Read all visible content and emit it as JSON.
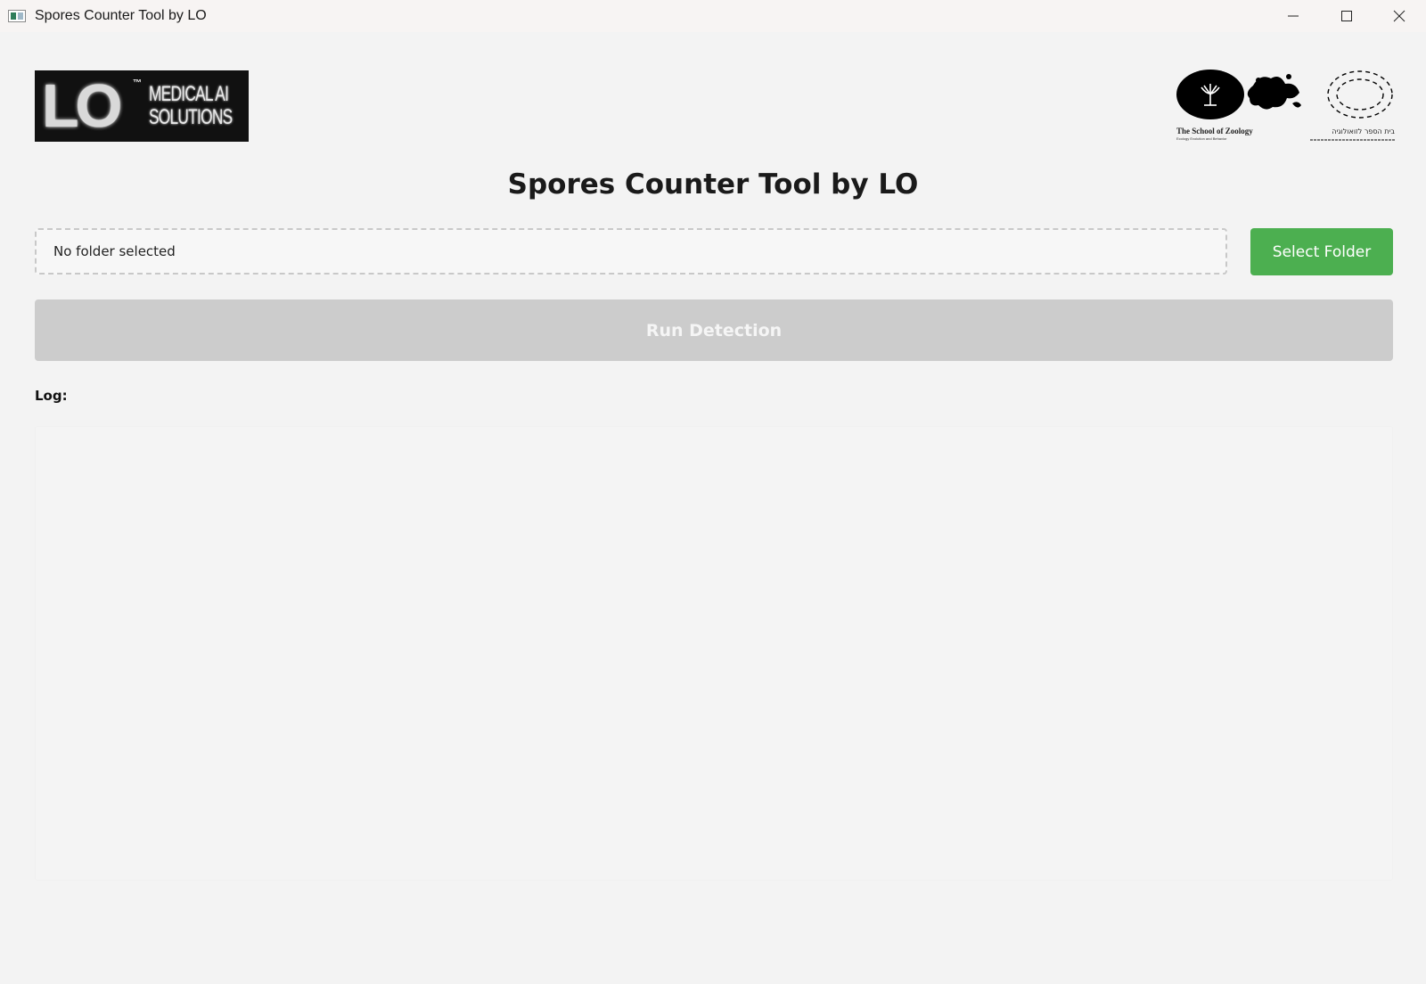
{
  "window": {
    "title": "Spores Counter Tool by LO",
    "controls": [
      "minimize",
      "maximize",
      "close"
    ]
  },
  "logos": {
    "left": {
      "letters": "LO",
      "trademark": "™",
      "line1": "MEDICAL AI",
      "line2": "SOLUTIONS"
    },
    "right": {
      "caption_en": "The School of Zoology",
      "caption_en_sub": "Ecology Evolution and Behavior",
      "caption_he": "בית הספר לזואולוגיה"
    }
  },
  "header": {
    "title": "Spores Counter Tool by LO"
  },
  "folder": {
    "value": "No folder selected",
    "select_label": "Select Folder"
  },
  "actions": {
    "run_label": "Run Detection"
  },
  "log": {
    "label": "Log:",
    "content": ""
  },
  "colors": {
    "select_button": "#4caf50",
    "run_button_disabled": "#cccccc",
    "background": "#f3f3f3"
  }
}
